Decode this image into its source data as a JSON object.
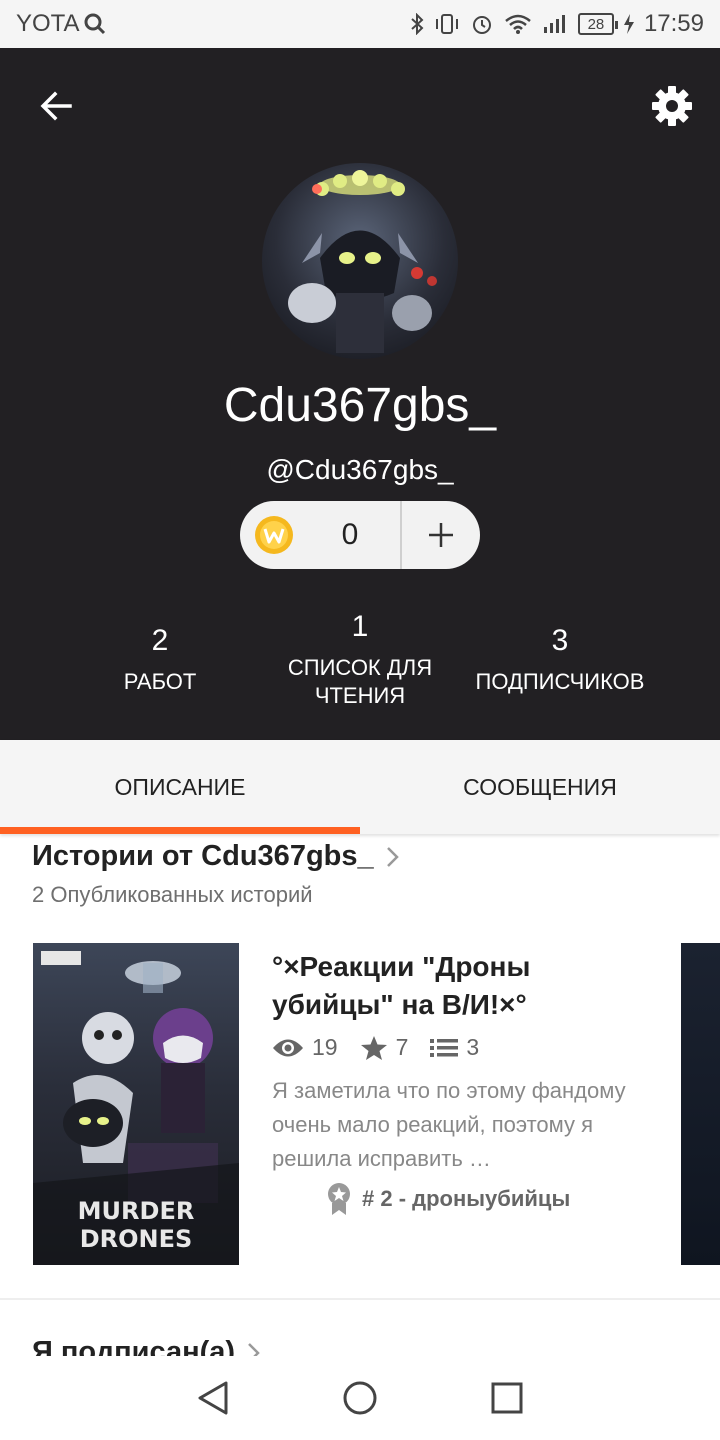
{
  "status_bar": {
    "carrier": "YOTA",
    "battery": "28",
    "time": "17:59"
  },
  "profile": {
    "display_name": "Cdu367gbs_",
    "handle": "@Cdu367gbs_",
    "coins": "0",
    "stats": {
      "works_count": "2",
      "works_label": "РАБОТ",
      "lists_count": "1",
      "lists_label": "СПИСОК ДЛЯ ЧТЕНИЯ",
      "followers_count": "3",
      "followers_label": "ПОДПИСЧИКОВ"
    }
  },
  "tabs": [
    {
      "label": "ОПИСАНИЕ",
      "active": true
    },
    {
      "label": "СООБЩЕНИЯ",
      "active": false
    }
  ],
  "stories_section": {
    "title": "Истории от Cdu367gbs_",
    "subtitle": "2 Опубликованных историй",
    "story": {
      "cover_text": "MURDER DRONES",
      "title": "°×Реакции \"Дроны убийцы\" на В/И!×°",
      "views": "19",
      "votes": "7",
      "parts": "3",
      "description": "Я заметила что по этому фандому очень мало реакций, поэтому я решила исправить …",
      "rank": "# 2 - дроныубийцы"
    }
  },
  "following_section": {
    "title": "Я подписан(а)"
  },
  "colors": {
    "header_bg": "#222023",
    "accent": "#ff6122",
    "coin": "#f5b81e"
  },
  "icons": [
    "back-arrow-icon",
    "settings-gear-icon",
    "coin-icon",
    "plus-icon",
    "eye-icon",
    "star-icon",
    "list-icon",
    "ribbon-icon",
    "chevron-right-icon"
  ]
}
